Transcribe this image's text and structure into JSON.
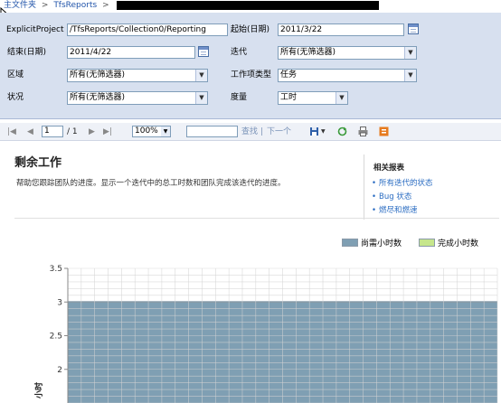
{
  "breadcrumb": {
    "items": [
      "主文件夹",
      "TfsReports"
    ],
    "separator": ">"
  },
  "params": {
    "explicit_project": {
      "label": "ExplicitProject",
      "value": "/TfsReports/Collection0/Reporting"
    },
    "start_date": {
      "label": "起始(日期)",
      "value": "2011/3/22"
    },
    "end_date": {
      "label": "结束(日期)",
      "value": "2011/4/22"
    },
    "iteration": {
      "label": "迭代",
      "value": "所有(无筛选器)"
    },
    "area": {
      "label": "区域",
      "value": "所有(无筛选器)"
    },
    "work_item_type": {
      "label": "工作项类型",
      "value": "任务"
    },
    "state": {
      "label": "状况",
      "value": "所有(无筛选器)"
    },
    "measure": {
      "label": "度量",
      "value": "工时"
    }
  },
  "toolbar": {
    "page_current": "1",
    "page_total": "/ 1",
    "zoom": "100%",
    "find_label": "查找",
    "find_sep": "|",
    "next_label": "下一个",
    "icons": [
      "first-page-icon",
      "prev-page-icon",
      "next-page-icon",
      "last-page-icon",
      "export-icon",
      "refresh-icon",
      "print-icon",
      "data-feed-icon"
    ]
  },
  "report": {
    "title": "剩余工作",
    "description": "帮助您跟踪团队的进度。显示一个迭代中的总工时数和团队完成该迭代的进度。",
    "related": {
      "heading": "相关报表",
      "links": [
        "所有迭代的状态",
        "Bug 状态",
        "燃尽和燃速"
      ]
    }
  },
  "chart_data": {
    "type": "area",
    "ylabel": "小时",
    "ylim": [
      1.5,
      3.5
    ],
    "yticks": [
      3.5,
      3,
      2.5,
      2
    ],
    "grid": true,
    "legend_placement": "top-right",
    "series": [
      {
        "name": "尚需小时数",
        "color": "#7f9fb3",
        "values": [
          3,
          3
        ]
      },
      {
        "name": "完成小时数",
        "color": "#c6e68c",
        "values": [
          0,
          0
        ]
      }
    ],
    "colors": {
      "remaining": "#7f9fb3",
      "completed": "#c6e68c",
      "grid": "#d3d3d3"
    }
  }
}
